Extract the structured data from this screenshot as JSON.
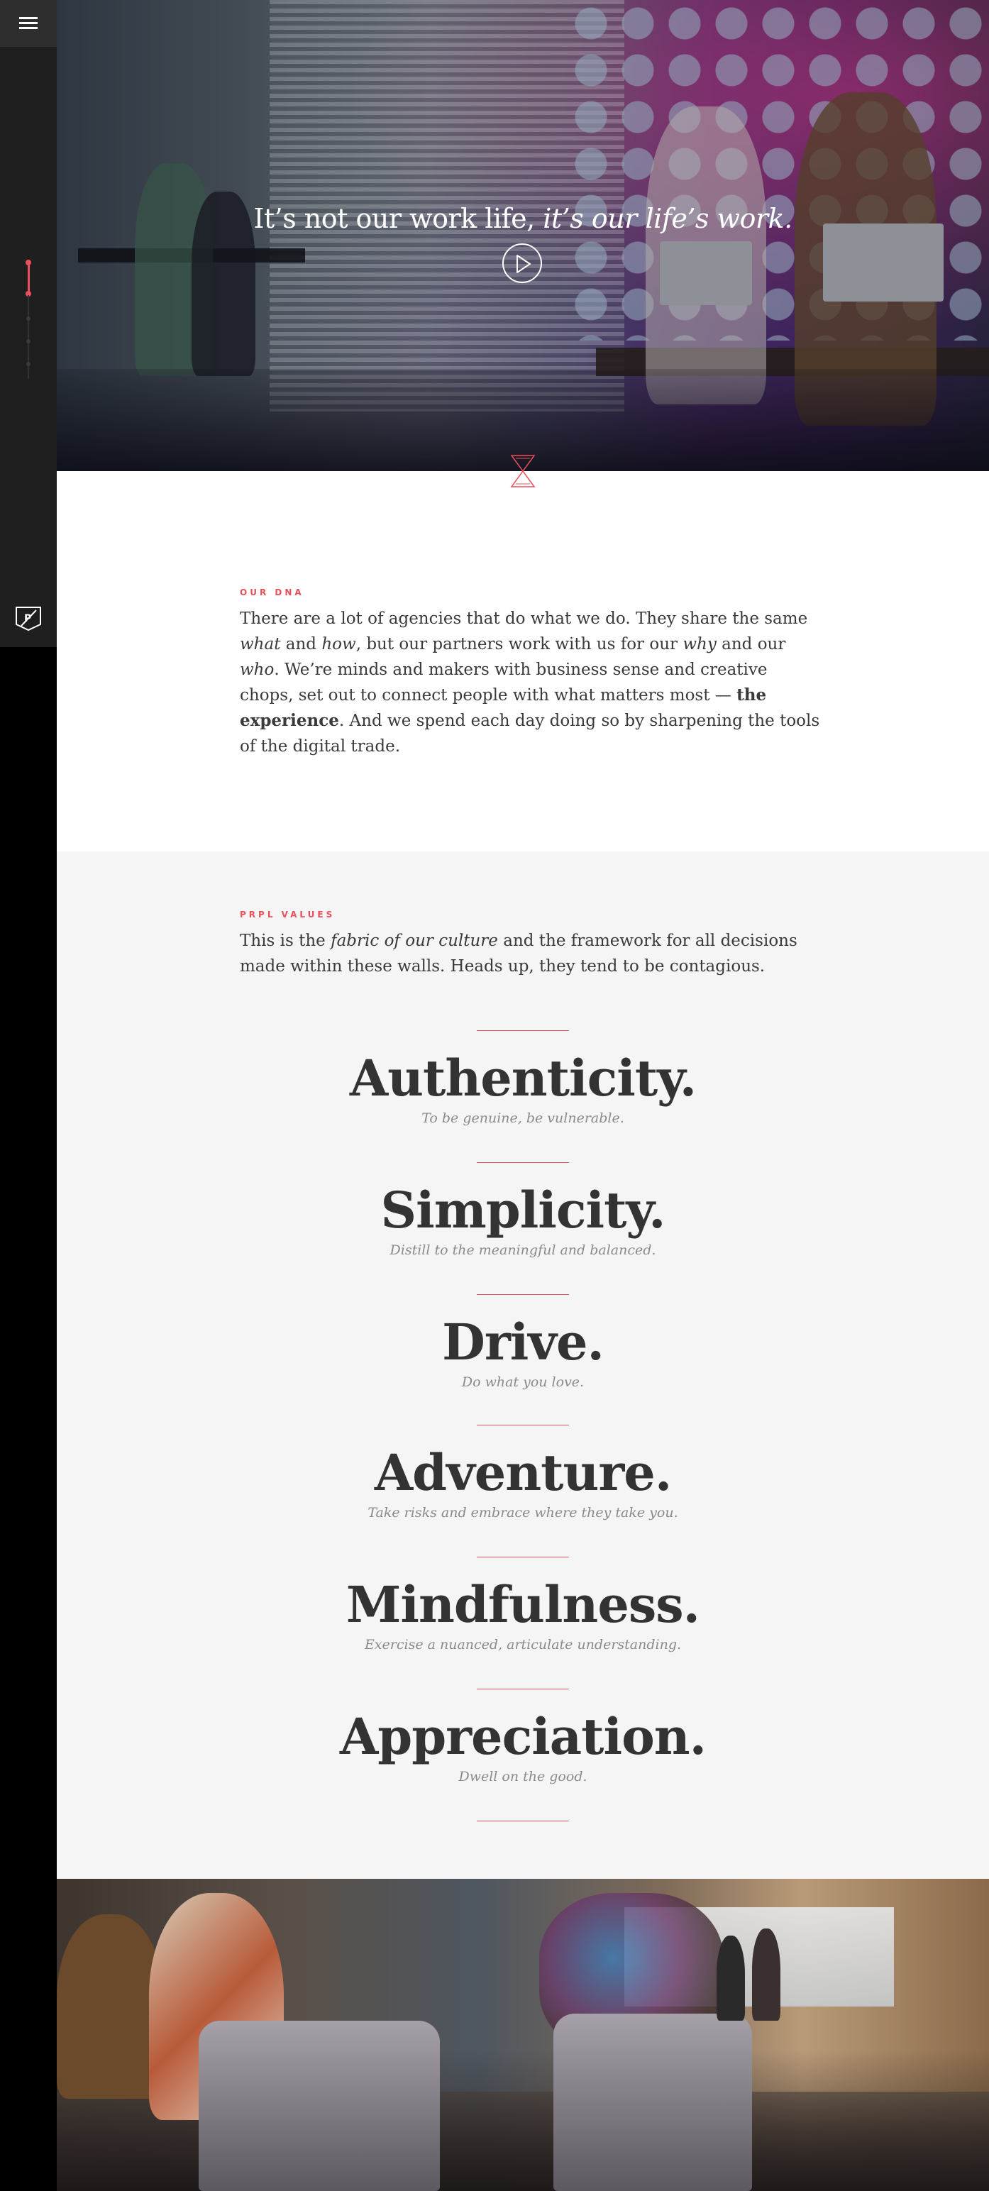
{
  "sidebar": {
    "menu_icon": "hamburger-menu-icon",
    "progress_icon": "section-progress-indicator",
    "logo_icon": "prpl-p-badge-logo",
    "colors": {
      "panel": "#1f1f1f",
      "accent": "#e8505b"
    }
  },
  "hero": {
    "title_plain": "It’s not our work life,",
    "title_italic": " it’s our life’s work.",
    "play_icon": "play-icon",
    "scroll_icon": "hourglass-icon"
  },
  "dna": {
    "label": "OUR DNA",
    "t1": "There are a lot of agencies that do what we do. They share the same ",
    "e1": "what",
    "t2": " and ",
    "e2": "how",
    "t3": ", but our partners work with us for our ",
    "e3": "why",
    "t4": " and our ",
    "e4": "who",
    "t5": ". We’re minds and makers with business sense and creative chops, set out to connect people with what matters most — ",
    "strong": "the experience",
    "t6": ". And we spend each day doing so by sharpening the tools of the digital trade."
  },
  "values": {
    "label": "PRPL VALUES",
    "intro_t1": "This is the ",
    "intro_em": "fabric of our culture",
    "intro_t2": " and the framework for all decisions made within these walls. Heads up, they tend to be contagious.",
    "items": [
      {
        "title": "Authenticity.",
        "subtitle": "To be genuine, be vulnerable."
      },
      {
        "title": "Simplicity.",
        "subtitle": "Distill to the meaningful and balanced."
      },
      {
        "title": "Drive.",
        "subtitle": "Do what you love."
      },
      {
        "title": "Adventure.",
        "subtitle": "Take risks and embrace where they take you."
      },
      {
        "title": "Mindfulness.",
        "subtitle": "Exercise a nuanced, articulate understanding."
      },
      {
        "title": "Appreciation.",
        "subtitle": "Dwell on the good."
      }
    ],
    "colors": {
      "background": "#f5f5f5",
      "divider": "#e8505b",
      "title": "#333333",
      "subtitle": "#8a8a8a"
    }
  }
}
